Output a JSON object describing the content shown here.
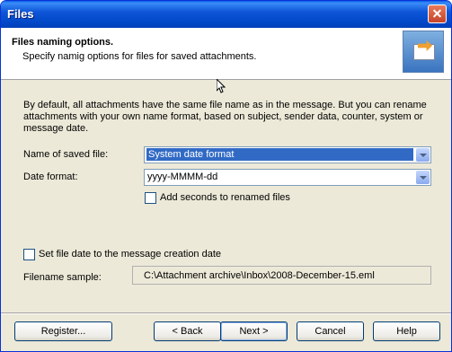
{
  "window": {
    "title": "Files"
  },
  "header": {
    "title": "Files naming options.",
    "subtitle": "Specify namig options for files for saved attachments."
  },
  "description": "By default, all attachments have the same file name as in the message. But you can rename attachments with your own name format, based on subject, sender data, counter, system or message date.",
  "form": {
    "name_label": "Name of saved file:",
    "name_value": "System date format",
    "date_label": "Date format:",
    "date_value": "yyyy-MMMM-dd",
    "add_seconds_label": "Add seconds to renamed files",
    "set_file_date_label": "Set file date to the message creation date",
    "sample_label": "Filename sample:",
    "sample_value": "C:\\Attachment archive\\Inbox\\2008-December-15.eml"
  },
  "buttons": {
    "register": "Register...",
    "back": "< Back",
    "next": "Next >",
    "cancel": "Cancel",
    "help": "Help"
  }
}
